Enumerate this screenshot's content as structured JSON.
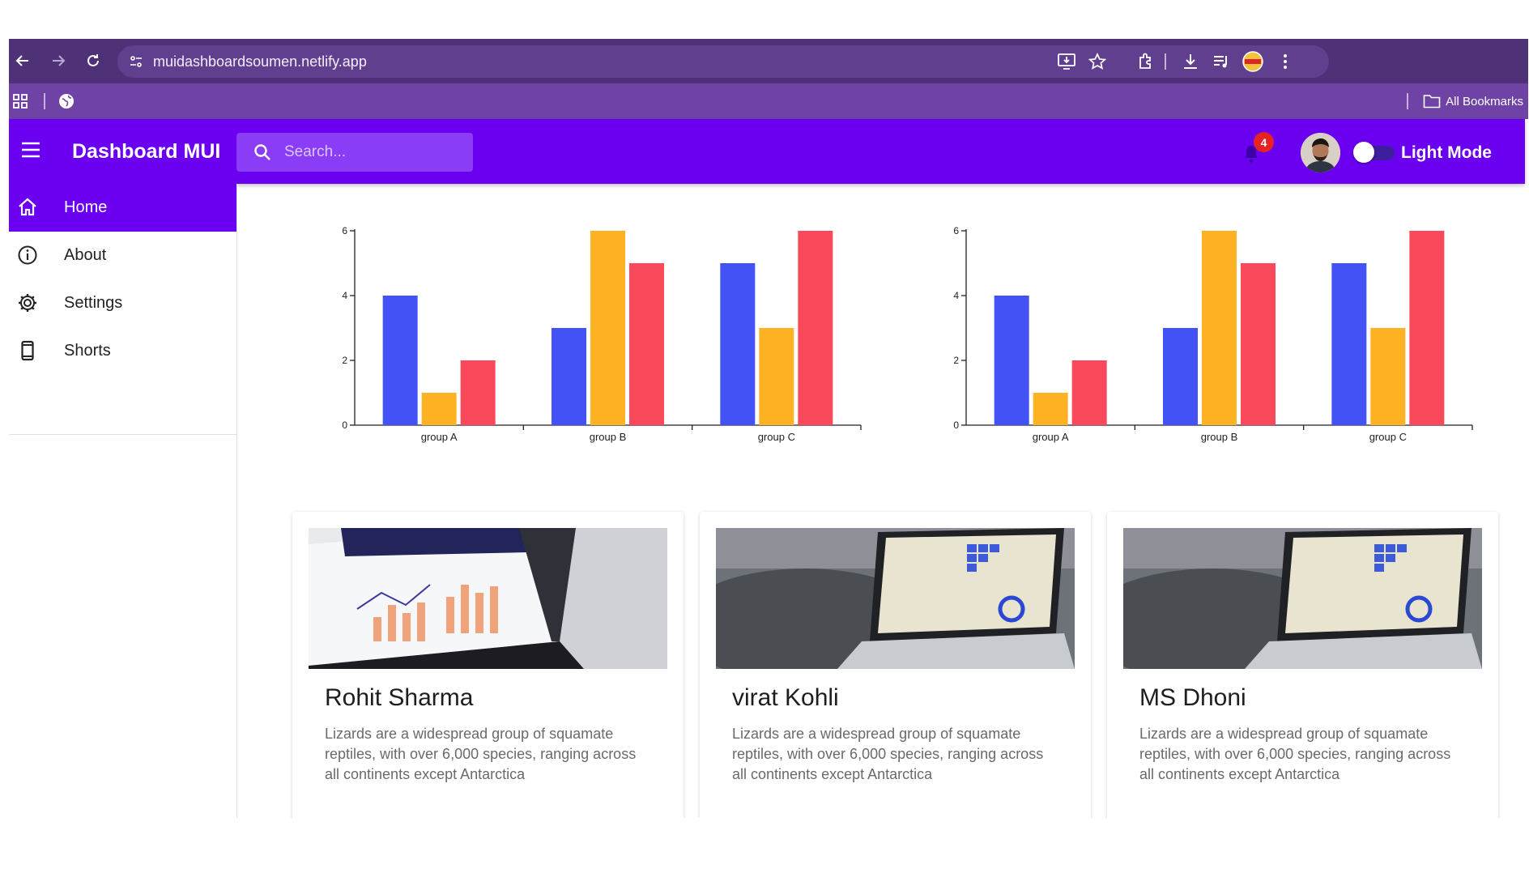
{
  "browser": {
    "url": "muidashboardsoumen.netlify.app",
    "bookmarks_label": "All Bookmarks"
  },
  "appbar": {
    "title": "Dashboard MUI",
    "search_placeholder": "Search...",
    "notification_count": "4",
    "mode_label": "Light Mode"
  },
  "sidebar": {
    "items": [
      {
        "label": "Home",
        "icon": "home-icon",
        "active": true
      },
      {
        "label": "About",
        "icon": "info-icon",
        "active": false
      },
      {
        "label": "Settings",
        "icon": "gear-icon",
        "active": false
      },
      {
        "label": "Shorts",
        "icon": "phone-icon",
        "active": false
      }
    ]
  },
  "colors": {
    "primary": "#6b00f0",
    "series_1": "#4252f4",
    "series_2": "#ffb224",
    "series_3": "#f9495a"
  },
  "chart_data": [
    {
      "type": "bar",
      "categories": [
        "group A",
        "group B",
        "group C"
      ],
      "series": [
        {
          "values": [
            4,
            3,
            5
          ]
        },
        {
          "values": [
            1,
            6,
            3
          ]
        },
        {
          "values": [
            2,
            5,
            6
          ]
        }
      ],
      "yticks": [
        0,
        2,
        4,
        6
      ],
      "ylim": [
        0,
        6
      ]
    },
    {
      "type": "bar",
      "categories": [
        "group A",
        "group B",
        "group C"
      ],
      "series": [
        {
          "values": [
            4,
            3,
            5
          ]
        },
        {
          "values": [
            1,
            6,
            3
          ]
        },
        {
          "values": [
            2,
            5,
            6
          ]
        }
      ],
      "yticks": [
        0,
        2,
        4,
        6
      ],
      "ylim": [
        0,
        6
      ]
    }
  ],
  "cards": [
    {
      "title": "Rohit Sharma",
      "text": "Lizards are a widespread group of squamate reptiles, with over 6,000 species, ranging across all continents except Antarctica"
    },
    {
      "title": "virat Kohli",
      "text": "Lizards are a widespread group of squamate reptiles, with over 6,000 species, ranging across all continents except Antarctica"
    },
    {
      "title": "MS Dhoni",
      "text": "Lizards are a widespread group of squamate reptiles, with over 6,000 species, ranging across all continents except Antarctica"
    }
  ]
}
